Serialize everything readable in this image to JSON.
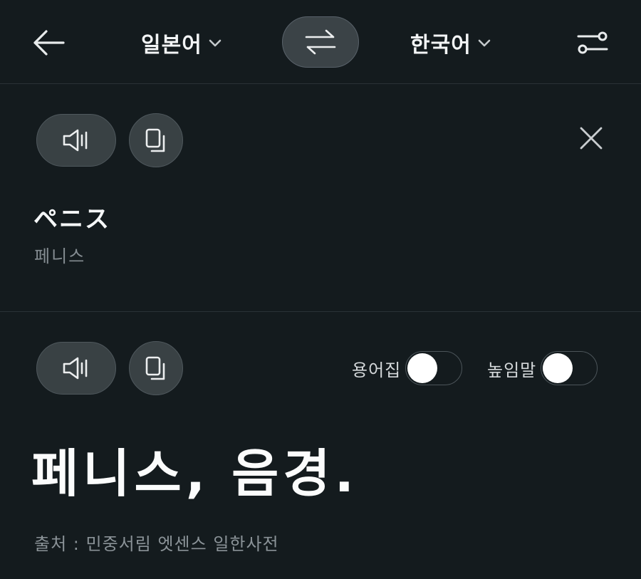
{
  "header": {
    "source_language": "일본어",
    "target_language": "한국어"
  },
  "icons": {
    "back": "arrow-left-icon",
    "chevron": "chevron-down-icon",
    "swap": "swap-arrows-icon",
    "settings": "sliders-icon",
    "speaker": "speaker-icon",
    "copy": "copy-icon",
    "close": "close-icon"
  },
  "source": {
    "text": "ペニス",
    "reading": "페니스"
  },
  "result": {
    "text": "페니스, 음경.",
    "glossary_label": "용어집",
    "glossary_on": false,
    "honorific_label": "높임말",
    "honorific_on": false,
    "attribution": "출처 : 민중서림 엣센스 일한사전"
  },
  "colors": {
    "background": "#141b1e",
    "button": "#394144",
    "divider": "#2a3236",
    "muted_text": "#858d92"
  }
}
